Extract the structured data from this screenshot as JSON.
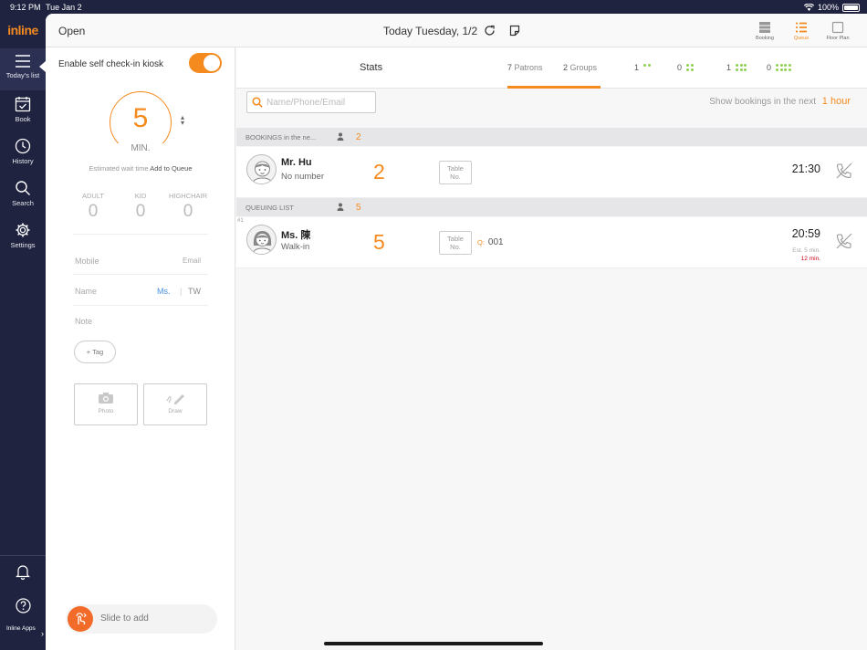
{
  "status": {
    "time": "9:12 PM",
    "date": "Tue Jan 2",
    "battery": "100%"
  },
  "brand": {
    "logo": "inline",
    "accent": "#f58a1f"
  },
  "nav": {
    "items": [
      {
        "label": "Today's list",
        "icon": "menu-icon"
      },
      {
        "label": "Book",
        "icon": "calendar-check-icon"
      },
      {
        "label": "History",
        "icon": "clock-icon"
      },
      {
        "label": "Search",
        "icon": "search-icon"
      },
      {
        "label": "Settings",
        "icon": "gear-icon"
      }
    ],
    "apps_label": "Inline Apps"
  },
  "topbar": {
    "status": "Open",
    "today": "Today Tuesday, 1/2",
    "views": [
      {
        "label": "Booking"
      },
      {
        "label": "Queue"
      },
      {
        "label": "Floor Plan"
      }
    ]
  },
  "form": {
    "kiosk_label": "Enable self check-in kiosk",
    "kiosk_enabled": true,
    "wait_minutes": "5",
    "wait_unit": "MIN.",
    "est_label": "Estimated wait time",
    "add_to_queue": "Add to Queue",
    "pax": [
      {
        "label": "ADULT",
        "value": "0"
      },
      {
        "label": "KID",
        "value": "0"
      },
      {
        "label": "HIGHCHAIR",
        "value": "0"
      }
    ],
    "mobile_placeholder": "Mobile",
    "email_placeholder": "Email",
    "name_placeholder": "Name",
    "title_value": "Ms.",
    "country_value": "TW",
    "note_placeholder": "Note",
    "tag_label": "Tag",
    "photo_label": "Photo",
    "draw_label": "Draw",
    "slide_label": "Slide to add"
  },
  "stats": {
    "title": "Stats",
    "patrons_count": "7",
    "patrons_label": "Patrons",
    "groups_count": "2",
    "groups_label": "Groups",
    "group_sizes": [
      {
        "count": "1",
        "dots": 2
      },
      {
        "count": "0",
        "dots": 4
      },
      {
        "count": "1",
        "dots": 6
      },
      {
        "count": "0",
        "dots": 8
      }
    ]
  },
  "search": {
    "placeholder": "Name/Phone/Email"
  },
  "next": {
    "label": "Show bookings in the next",
    "value": "1 hour"
  },
  "bookings": {
    "header": "BOOKINGS in the ne...",
    "count": "2",
    "rows": [
      {
        "name": "Mr. Hu",
        "sub": "No number",
        "party": "2",
        "table_line1": "Table",
        "table_line2": "No.",
        "time": "21:30"
      }
    ]
  },
  "queue": {
    "header": "QUEUING LIST",
    "count": "5",
    "rows": [
      {
        "index": "#1",
        "name": "Ms. 陳",
        "sub": "Walk-in",
        "party": "5",
        "table_line1": "Table",
        "table_line2": "No.",
        "q_label": "Q:",
        "q_number": "001",
        "time": "20:59",
        "est": "Est. 5 min.",
        "elapsed": "12 min."
      }
    ]
  }
}
